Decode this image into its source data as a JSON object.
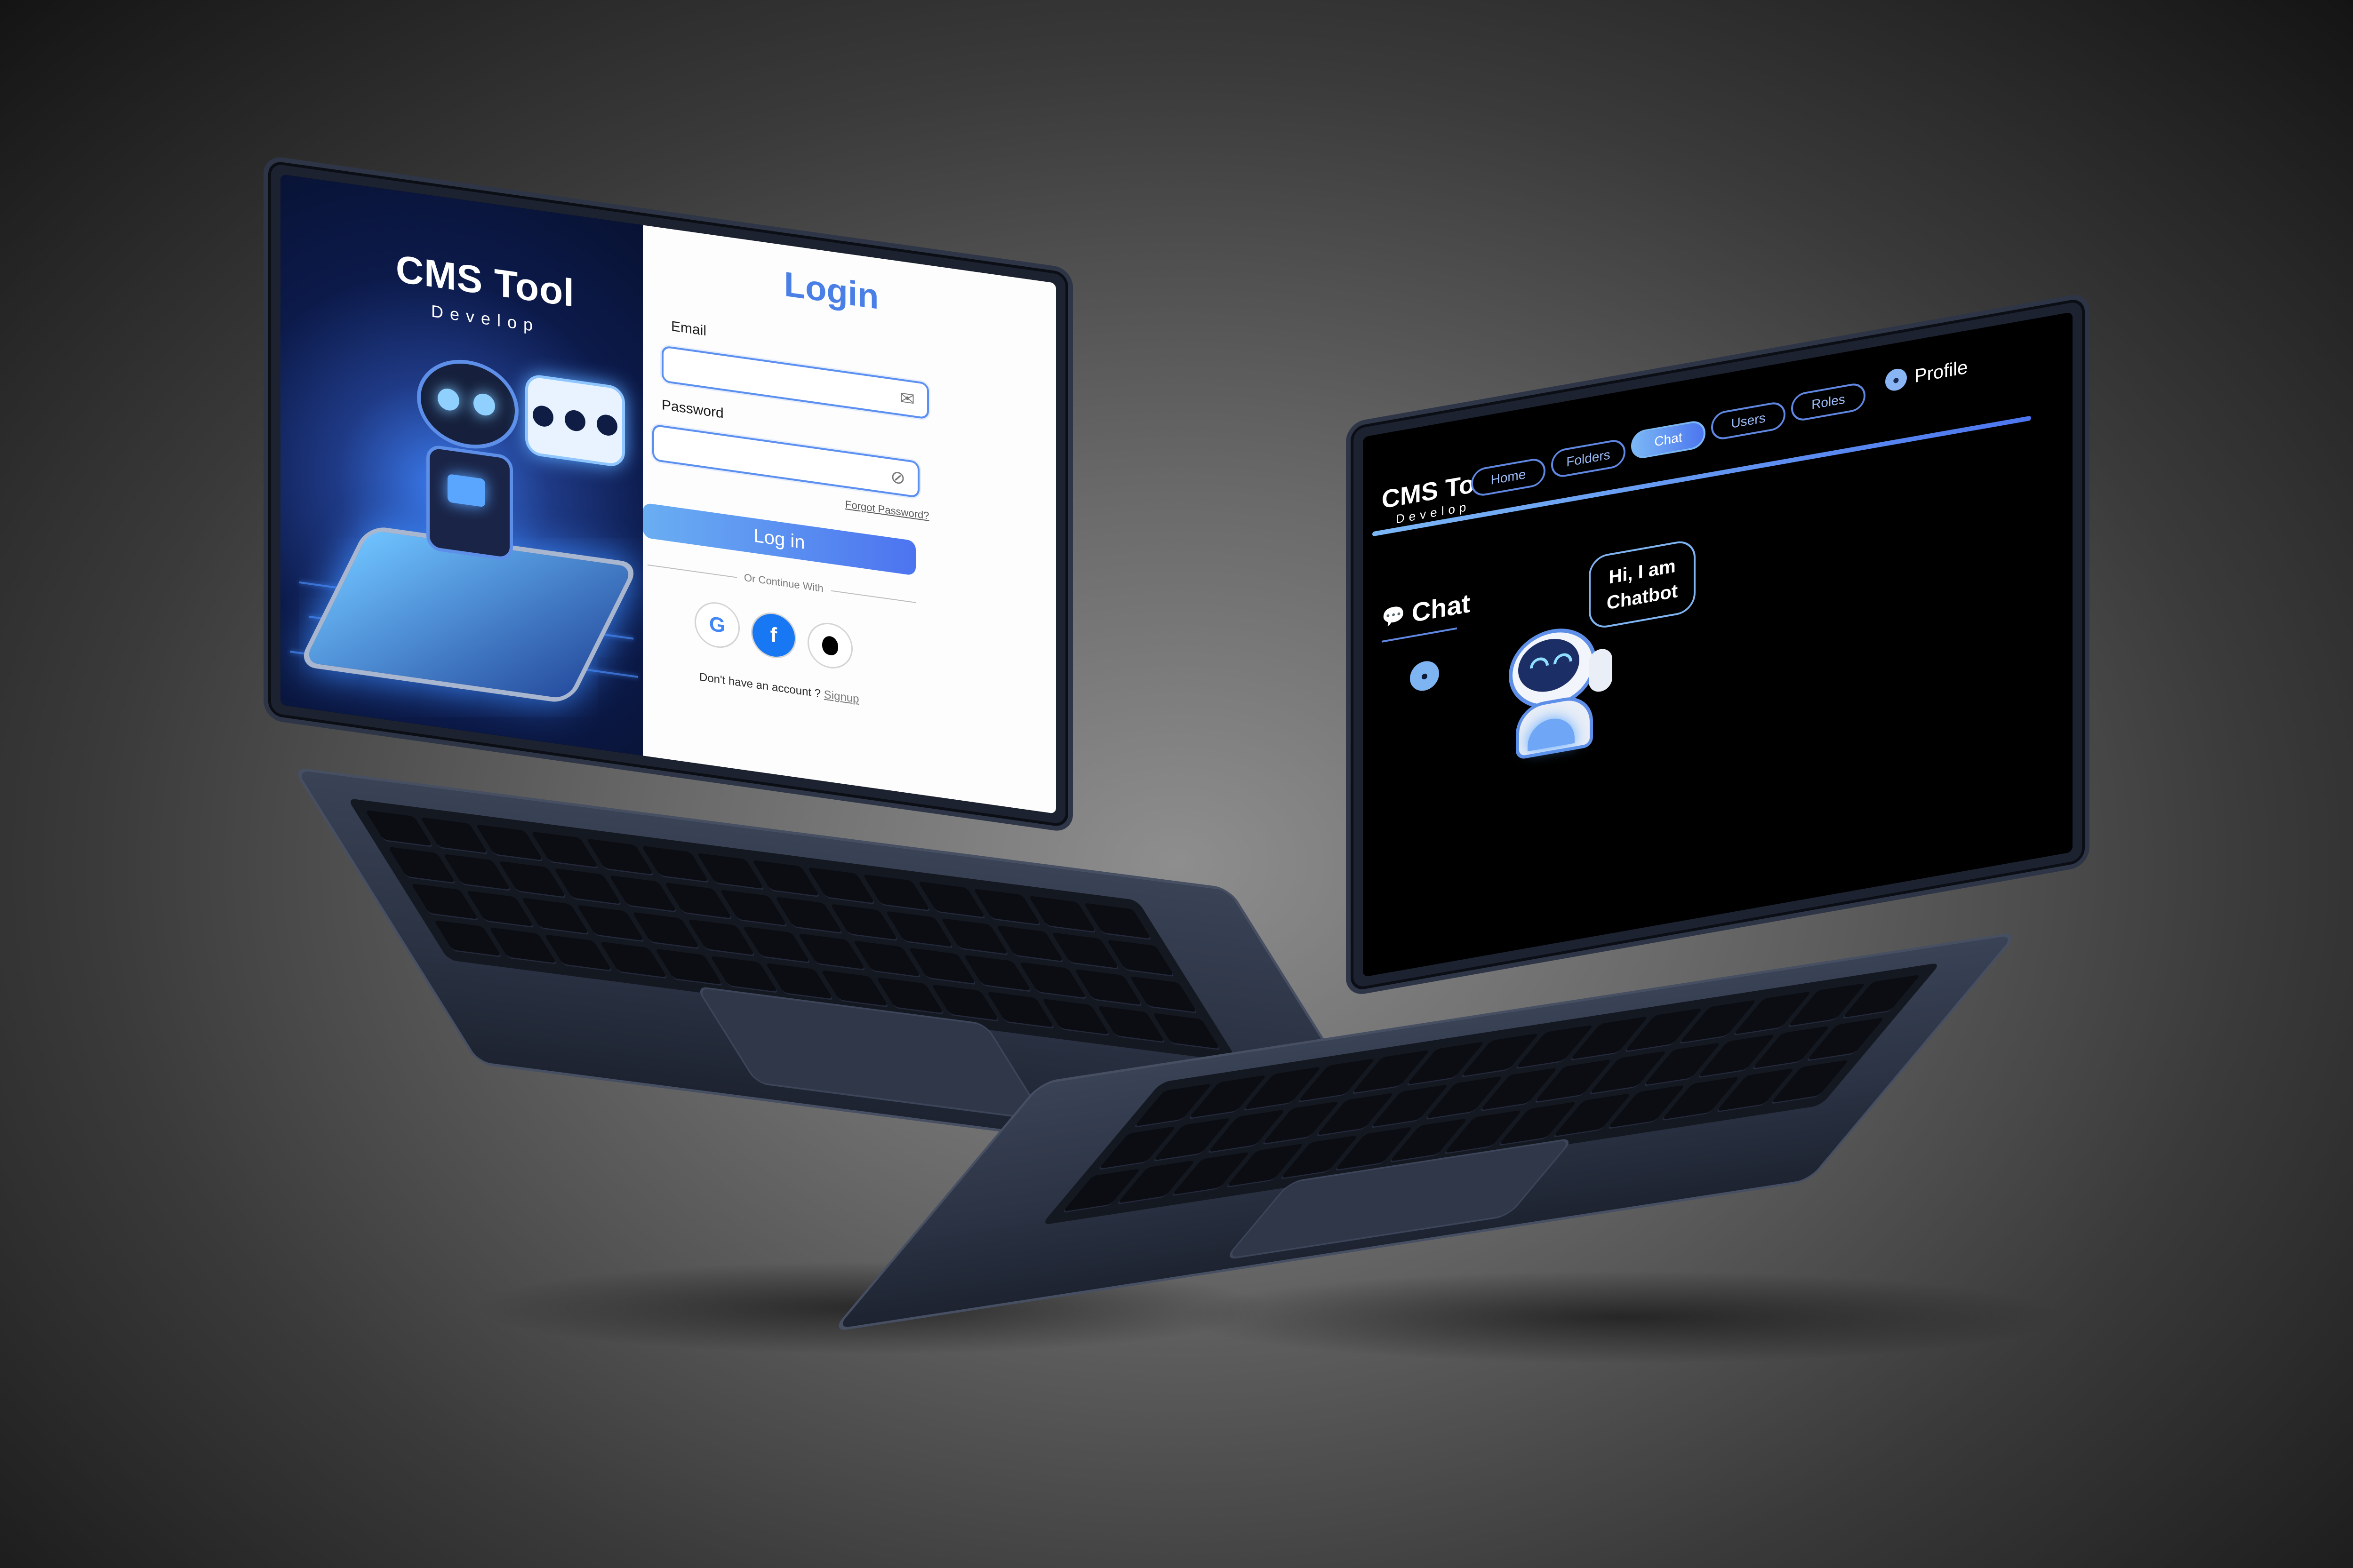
{
  "login_screen": {
    "brand": {
      "title": "CMS Tool",
      "subtitle": "Develop"
    },
    "heading": "Login",
    "email": {
      "label": "Email",
      "value": "",
      "placeholder": ""
    },
    "password": {
      "label": "Password",
      "value": "",
      "placeholder": ""
    },
    "forgot_password": "Forgot Password?",
    "login_button": "Log in",
    "divider_text": "Or Continue With",
    "social": [
      {
        "name": "google-icon",
        "glyph": "G",
        "color": "#4285f4"
      },
      {
        "name": "facebook-icon",
        "glyph": "f",
        "color": "#1877f2"
      },
      {
        "name": "apple-icon",
        "glyph": "",
        "color": "#000000"
      }
    ],
    "signup_prompt": "Don't have an account ? ",
    "signup_link": "Signup",
    "illustration_icons": [
      "robot-icon",
      "speech-bubble-icon",
      "smartphone-icon"
    ]
  },
  "chat_screen": {
    "brand": {
      "title": "CMS Tool",
      "subtitle": "Develop"
    },
    "nav": [
      {
        "label": "Home",
        "active": false
      },
      {
        "label": "Folders",
        "active": false
      },
      {
        "label": "Chat",
        "active": true
      },
      {
        "label": "Users",
        "active": false
      },
      {
        "label": "Roles",
        "active": false
      }
    ],
    "profile_label": "Profile",
    "section_title": "Chat",
    "bubble_line1": "Hi, I am",
    "bubble_line2": "Chatbot"
  },
  "colors": {
    "accent": "#4c76ef",
    "accent_light": "#7bb7f5",
    "login_panel": "#fdfdfe",
    "chat_background": "#000000"
  }
}
